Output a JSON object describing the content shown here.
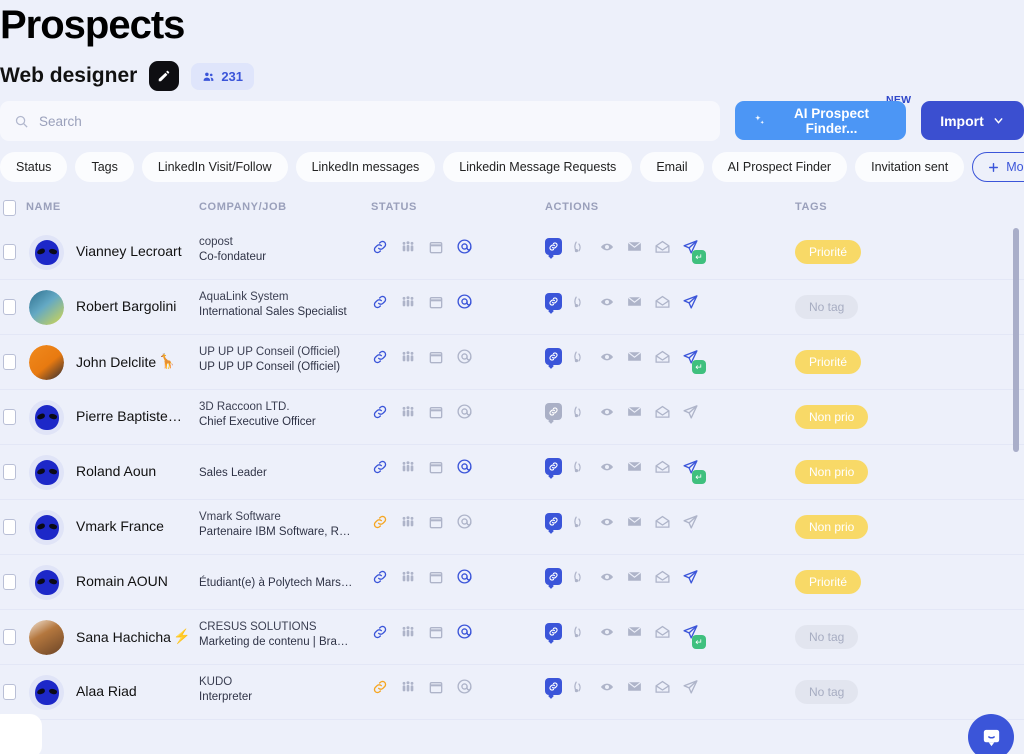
{
  "header": {
    "title": "Prospects",
    "subtitle": "Web designer",
    "campaign_icon": "pen-icon",
    "count_badge": {
      "icon": "people-icon",
      "value": "231"
    }
  },
  "search": {
    "placeholder": "Search",
    "icon": "search-icon"
  },
  "toolbar": {
    "ai_button": {
      "label": "AI Prospect Finder...",
      "icon": "sparkle-icon",
      "flag": "NEW",
      "color": "#4c96f5"
    },
    "import_button": {
      "label": "Import",
      "icon": "chevron-down-icon",
      "color": "#3b4fd0"
    }
  },
  "filters": {
    "chips": [
      "Status",
      "Tags",
      "LinkedIn Visit/Follow",
      "LinkedIn messages",
      "Linkedin Message Requests",
      "Email",
      "AI Prospect Finder",
      "Invitation sent"
    ],
    "more": {
      "label": "More filters",
      "icon": "plus-icon",
      "color": "#3b55d9"
    }
  },
  "table": {
    "columns": [
      "NAME",
      "COMPANY/JOB",
      "STATUS",
      "ACTIONS",
      "TAGS"
    ],
    "rows": [
      {
        "name": "Vianney Lecroart",
        "emoji": "",
        "avatar": "alien",
        "company": "copost",
        "job": "Co-fondateur",
        "status": {
          "link": "blue",
          "people": "gray",
          "calendar": "gray",
          "at": "blue"
        },
        "actions": {
          "link_badge": "blue",
          "rss": "gray",
          "eye": "gray",
          "mail": "gray",
          "open_mail": "gray",
          "send": "blue",
          "replied": true
        },
        "tag": {
          "label": "Priorité",
          "style": "yellow"
        }
      },
      {
        "name": "Robert Bargolini",
        "emoji": "",
        "avatar": "photo-teal",
        "company": "AquaLink System",
        "job": "International Sales Specialist",
        "status": {
          "link": "blue",
          "people": "gray",
          "calendar": "gray",
          "at": "blue"
        },
        "actions": {
          "link_badge": "blue",
          "rss": "gray",
          "eye": "gray",
          "mail": "gray",
          "open_mail": "gray",
          "send": "blue",
          "replied": false
        },
        "tag": {
          "label": "No tag",
          "style": "gray"
        }
      },
      {
        "name": "John Delclite",
        "emoji": "🦒",
        "avatar": "photo-orange",
        "company": "UP UP UP Conseil (Officiel)",
        "job": "UP UP UP Conseil (Officiel)",
        "status": {
          "link": "blue",
          "people": "gray",
          "calendar": "gray",
          "at": "gray"
        },
        "actions": {
          "link_badge": "blue",
          "rss": "gray",
          "eye": "gray",
          "mail": "gray",
          "open_mail": "gray",
          "send": "blue",
          "replied": true
        },
        "tag": {
          "label": "Priorité",
          "style": "yellow"
        }
      },
      {
        "name": "Pierre Baptiste…",
        "emoji": "",
        "avatar": "alien",
        "company": "3D Raccoon LTD.",
        "job": "Chief Executive Officer",
        "status": {
          "link": "blue",
          "people": "gray",
          "calendar": "gray",
          "at": "gray"
        },
        "actions": {
          "link_badge": "gray",
          "rss": "gray",
          "eye": "gray",
          "mail": "gray",
          "open_mail": "gray",
          "send": "gray",
          "replied": false
        },
        "tag": {
          "label": "Non prio",
          "style": "yellow"
        }
      },
      {
        "name": "Roland Aoun",
        "emoji": "",
        "avatar": "alien",
        "company": "",
        "job": "Sales Leader",
        "status": {
          "link": "blue",
          "people": "gray",
          "calendar": "gray",
          "at": "blue"
        },
        "actions": {
          "link_badge": "blue",
          "rss": "gray",
          "eye": "gray",
          "mail": "gray",
          "open_mail": "gray",
          "send": "blue",
          "replied": true
        },
        "tag": {
          "label": "Non prio",
          "style": "yellow"
        }
      },
      {
        "name": "Vmark France",
        "emoji": "",
        "avatar": "alien",
        "company": "Vmark Software",
        "job": "Partenaire IBM Software, R…",
        "status": {
          "link": "orange",
          "people": "gray",
          "calendar": "gray",
          "at": "gray"
        },
        "actions": {
          "link_badge": "blue",
          "rss": "gray",
          "eye": "gray",
          "mail": "gray",
          "open_mail": "gray",
          "send": "gray",
          "replied": false
        },
        "tag": {
          "label": "Non prio",
          "style": "yellow"
        }
      },
      {
        "name": "Romain AOUN",
        "emoji": "",
        "avatar": "alien",
        "company": "",
        "job": "Étudiant(e) à Polytech Mars…",
        "status": {
          "link": "blue",
          "people": "gray",
          "calendar": "gray",
          "at": "blue"
        },
        "actions": {
          "link_badge": "blue",
          "rss": "gray",
          "eye": "gray",
          "mail": "gray",
          "open_mail": "gray",
          "send": "blue",
          "replied": false
        },
        "tag": {
          "label": "Priorité",
          "style": "yellow"
        }
      },
      {
        "name": "Sana Hachicha",
        "emoji": "⚡",
        "avatar": "photo-brown",
        "company": "CRESUS SOLUTIONS",
        "job": "Marketing de contenu | Bra…",
        "status": {
          "link": "blue",
          "people": "gray",
          "calendar": "gray",
          "at": "blue"
        },
        "actions": {
          "link_badge": "blue",
          "rss": "gray",
          "eye": "gray",
          "mail": "gray",
          "open_mail": "gray",
          "send": "blue",
          "replied": true
        },
        "tag": {
          "label": "No tag",
          "style": "gray"
        }
      },
      {
        "name": "Alaa Riad",
        "emoji": "",
        "avatar": "alien",
        "company": "KUDO",
        "job": "Interpreter",
        "status": {
          "link": "orange",
          "people": "gray",
          "calendar": "gray",
          "at": "gray"
        },
        "actions": {
          "link_badge": "blue",
          "rss": "gray",
          "eye": "gray",
          "mail": "gray",
          "open_mail": "gray",
          "send": "gray",
          "replied": false
        },
        "tag": {
          "label": "No tag",
          "style": "gray"
        }
      }
    ]
  },
  "chat_widget": {
    "icon": "chat-bubble-icon",
    "color": "#3b55d9"
  }
}
